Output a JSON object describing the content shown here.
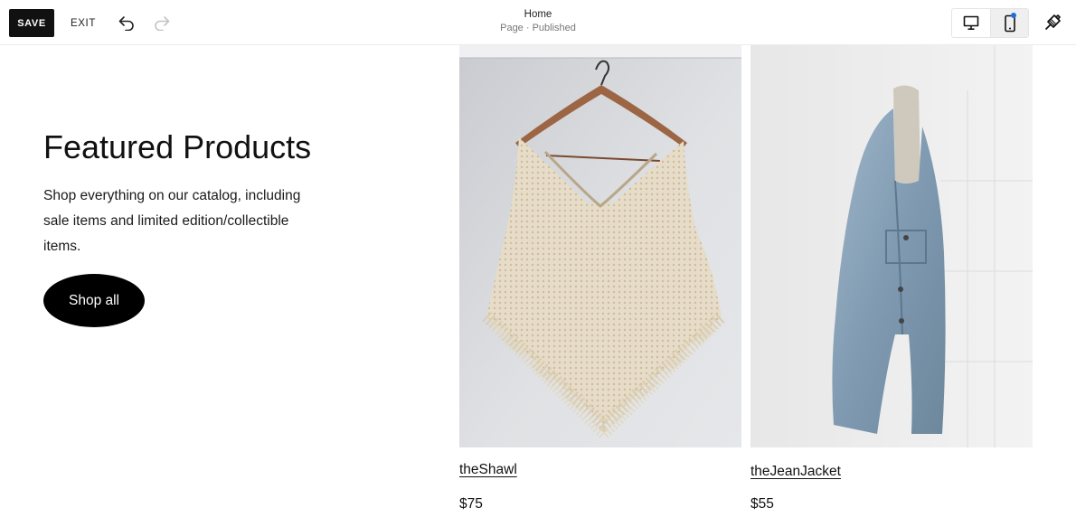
{
  "toolbar": {
    "save_label": "SAVE",
    "exit_label": "EXIT",
    "undo_icon": "undo-icon",
    "redo_icon": "redo-icon",
    "page_title": "Home",
    "page_status": "Page · Published",
    "desktop_icon": "desktop-icon",
    "mobile_icon": "mobile-icon",
    "design_icon": "paintbrush-icon",
    "notification_color": "#1e6fd9"
  },
  "hero": {
    "heading": "Featured Products",
    "description": "Shop everything on our catalog, including sale items and limited edition/collectible items.",
    "button_label": "Shop all"
  },
  "products": [
    {
      "name": "theShawl",
      "price": "$75",
      "image": "cream knit fringe poncho on wooden hanger"
    },
    {
      "name": "theJeanJacket",
      "price": "$55",
      "image": "denim jacket with sherpa collar hanging on white wall"
    }
  ]
}
